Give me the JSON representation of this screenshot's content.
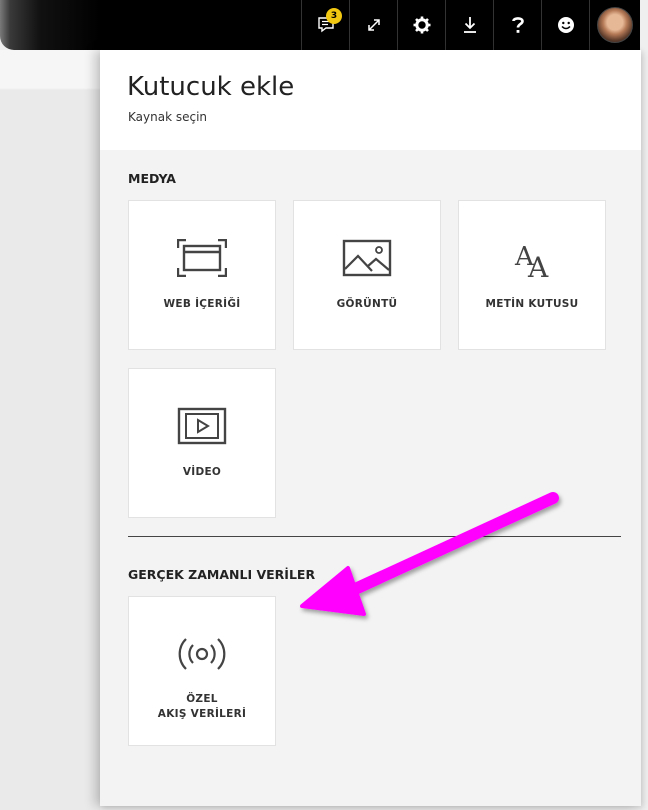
{
  "topbar": {
    "notification_count": "3",
    "icons": [
      "chat-notification-icon",
      "expand-icon",
      "gear-icon",
      "download-icon",
      "help-icon",
      "smiley-icon"
    ]
  },
  "panel": {
    "title": "Kutucuk ekle",
    "subtitle": "Kaynak seçin",
    "sections": [
      {
        "label": "MEDYA",
        "tiles": [
          {
            "label": "WEB İÇERİĞİ",
            "icon": "web-content-icon"
          },
          {
            "label": "GÖRÜNTÜ",
            "icon": "image-icon"
          },
          {
            "label": "METİN KUTUSU",
            "icon": "text-box-icon"
          },
          {
            "label": "VİDEO",
            "icon": "video-icon"
          }
        ]
      },
      {
        "label": "GERÇEK ZAMANLI VERİLER",
        "tiles": [
          {
            "label_line1": "ÖZEL",
            "label_line2": "AKIŞ VERİLERİ",
            "icon": "streaming-icon"
          }
        ]
      }
    ]
  },
  "colors": {
    "accent_arrow": "#ff00ff",
    "badge": "#f2c811",
    "topbar": "#000000",
    "panel_bg": "#f3f3f3"
  }
}
